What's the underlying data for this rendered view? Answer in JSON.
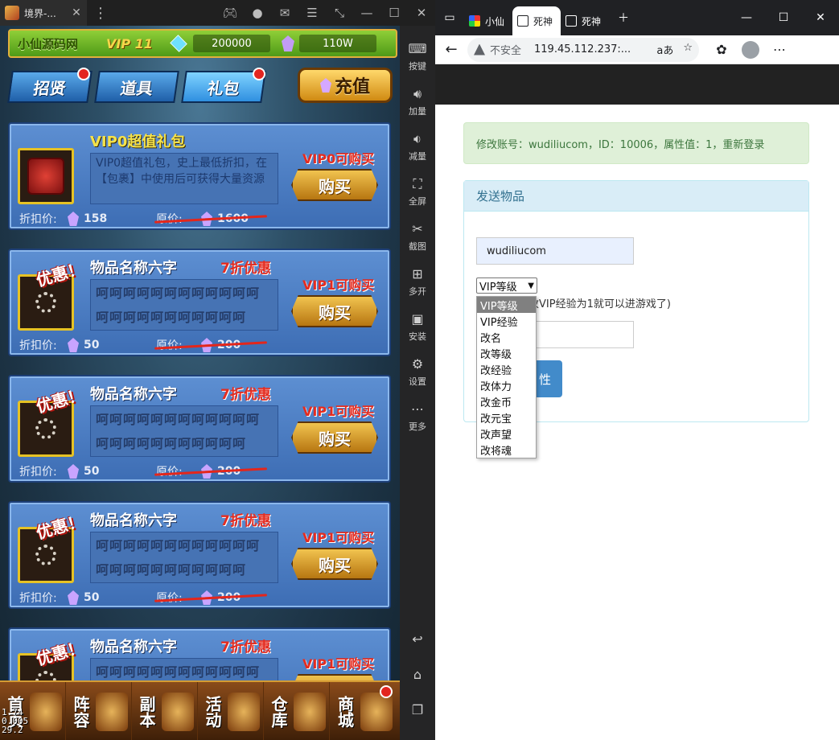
{
  "emulator": {
    "tab_title": "境界-...",
    "sidebar": [
      {
        "label": "按键",
        "icon": "keyboard-icon"
      },
      {
        "label": "加量",
        "icon": "volume-up-icon"
      },
      {
        "label": "减量",
        "icon": "volume-down-icon"
      },
      {
        "label": "全屏",
        "icon": "fullscreen-icon"
      },
      {
        "label": "截图",
        "icon": "scissors-icon"
      },
      {
        "label": "多开",
        "icon": "multi-instance-icon"
      },
      {
        "label": "安装",
        "icon": "apk-icon"
      },
      {
        "label": "设置",
        "icon": "gear-icon"
      },
      {
        "label": "更多",
        "icon": "more-icon"
      }
    ],
    "android_nav": [
      "back-icon",
      "home-icon",
      "recents-icon"
    ]
  },
  "game": {
    "hud": {
      "brand": "小仙源码网",
      "vip": "VIP 11",
      "gems": "200000",
      "crystals": "110W"
    },
    "tabs": [
      "招贤",
      "道具",
      "礼包"
    ],
    "active_tab": "礼包",
    "recharge_label": "充值",
    "cards": [
      {
        "name": "VIP0超值礼包",
        "tag": "",
        "ribbon": "",
        "desc": "VIP0超值礼包，史上最低折扣，在【包裹】中使用后可获得大量资源",
        "vip_label": "VIP0可购买",
        "buy": "购买",
        "price_label": "折扣价:",
        "price": "158",
        "orig_label": "原价:",
        "orig": "1600"
      },
      {
        "name": "物品名称六字",
        "tag": "7折优惠",
        "ribbon": "优惠！",
        "desc": "呵呵呵呵呵呵呵呵呵呵呵呵呵呵呵呵呵呵呵呵呵呵呵",
        "vip_label": "VIP1可购买",
        "buy": "购买",
        "price_label": "折扣价:",
        "price": "50",
        "orig_label": "原价:",
        "orig": "200"
      },
      {
        "name": "物品名称六字",
        "tag": "7折优惠",
        "ribbon": "优惠！",
        "desc": "呵呵呵呵呵呵呵呵呵呵呵呵呵呵呵呵呵呵呵呵呵呵呵",
        "vip_label": "VIP1可购买",
        "buy": "购买",
        "price_label": "折扣价:",
        "price": "50",
        "orig_label": "原价:",
        "orig": "200"
      },
      {
        "name": "物品名称六字",
        "tag": "7折优惠",
        "ribbon": "优惠！",
        "desc": "呵呵呵呵呵呵呵呵呵呵呵呵呵呵呵呵呵呵呵呵呵呵呵",
        "vip_label": "VIP1可购买",
        "buy": "购买",
        "price_label": "折扣价:",
        "price": "50",
        "orig_label": "原价:",
        "orig": "200"
      },
      {
        "name": "物品名称六字",
        "tag": "7折优惠",
        "ribbon": "优惠！",
        "desc": "呵呵呵呵呵呵呵呵呵呵呵呵",
        "vip_label": "VIP1可购买",
        "buy": "购买",
        "price_label": "",
        "price": "",
        "orig_label": "",
        "orig": ""
      }
    ],
    "bottom_nav": [
      "首页",
      "阵容",
      "副本",
      "活动",
      "仓库",
      "商城"
    ],
    "fps_overlay": "1.74\n0.005\n29.2"
  },
  "browser": {
    "tabs": [
      "小仙",
      "死神",
      "死神"
    ],
    "active_tab_index": 1,
    "address": {
      "security": "不安全",
      "url": "119.45.112.237:..."
    },
    "alert": "修改账号：wudiliucom，ID：10006，属性值：1，重新登录",
    "panel_title": "发送物品",
    "account_value": "wudiliucom",
    "select_value": "VIP等级",
    "hint": "改VIP经验为1就可以进游戏了)",
    "submit_label": "性",
    "options": [
      "VIP等级",
      "VIP经验",
      "改名",
      "改等级",
      "改经验",
      "改体力",
      "改金币",
      "改元宝",
      "改声望",
      "改将魂"
    ],
    "colors": {
      "alert_bg": "#dff0d8",
      "alert_text": "#3c763d",
      "panel_head": "#d9edf7",
      "button": "#428bca"
    }
  }
}
